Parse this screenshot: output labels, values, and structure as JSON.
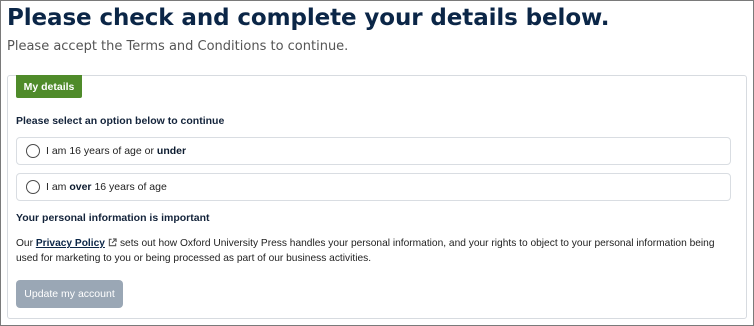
{
  "header": {
    "title": "Please check and complete your details below.",
    "subtitle": "Please accept the Terms and Conditions to continue."
  },
  "panel": {
    "tab_label": "My details",
    "select_prompt": "Please select an option below to continue",
    "options": [
      {
        "text_before": "I am 16 years of age or ",
        "bold": "under",
        "text_after": ""
      },
      {
        "text_before": "I am ",
        "bold": "over",
        "text_after": " 16 years of age"
      }
    ],
    "info_heading": "Your personal information is important",
    "info": {
      "prefix": "Our ",
      "link_text": "Privacy Policy",
      "link_icon": "external-link-icon",
      "suffix": "sets out how Oxford University Press handles your personal information, and your rights to object to your personal information being used for marketing to you or being processed as part of our business activities."
    },
    "update_button_label": "Update my account"
  },
  "colors": {
    "title": "#0b2647",
    "tab_bg": "#4f8b2a",
    "button_disabled_bg": "#9aa7b5",
    "border": "#d9dde2"
  }
}
